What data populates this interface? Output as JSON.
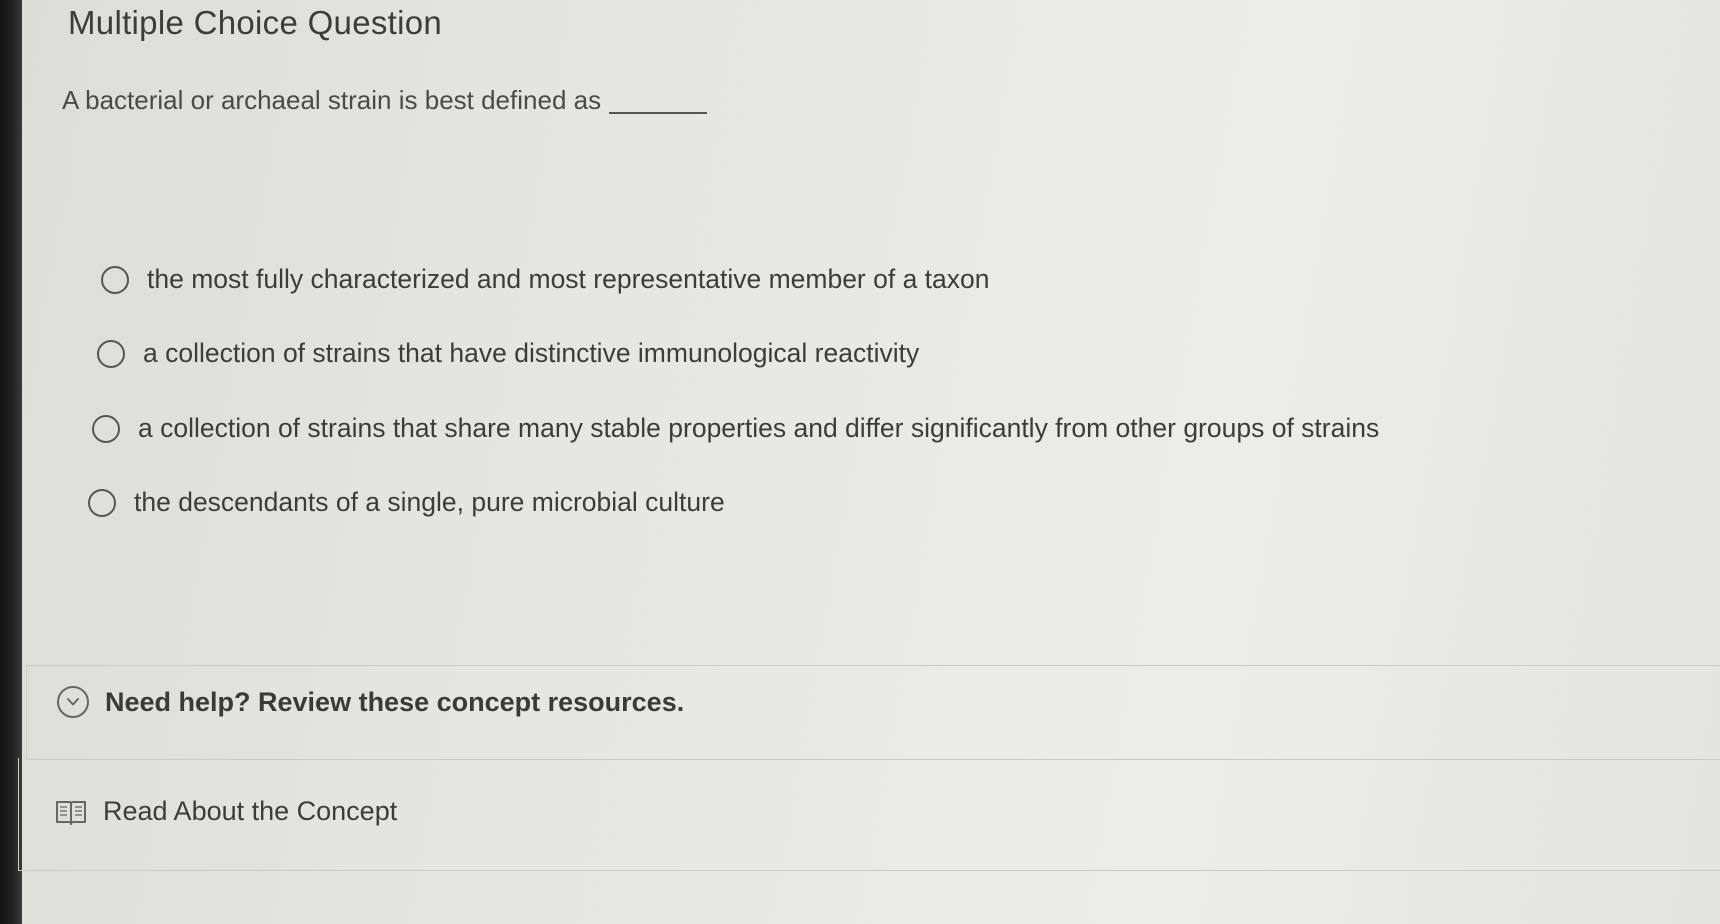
{
  "question": {
    "title": "Multiple Choice Question",
    "prompt": "A bacterial or archaeal strain is best defined as"
  },
  "options": [
    {
      "label": "the most fully characterized and most representative member of a taxon",
      "selected": false
    },
    {
      "label": "a collection of strains that have distinctive immunological reactivity",
      "selected": false
    },
    {
      "label": "a collection of strains that share many stable properties and differ significantly from other groups of strains",
      "selected": false
    },
    {
      "label": "the descendants of a single, pure microbial culture",
      "selected": false
    }
  ],
  "help": {
    "label": "Need help? Review these concept resources.",
    "icon": "chevron-down-circle-icon"
  },
  "resources": [
    {
      "label": "Read About the Concept",
      "icon": "book-icon"
    }
  ]
}
